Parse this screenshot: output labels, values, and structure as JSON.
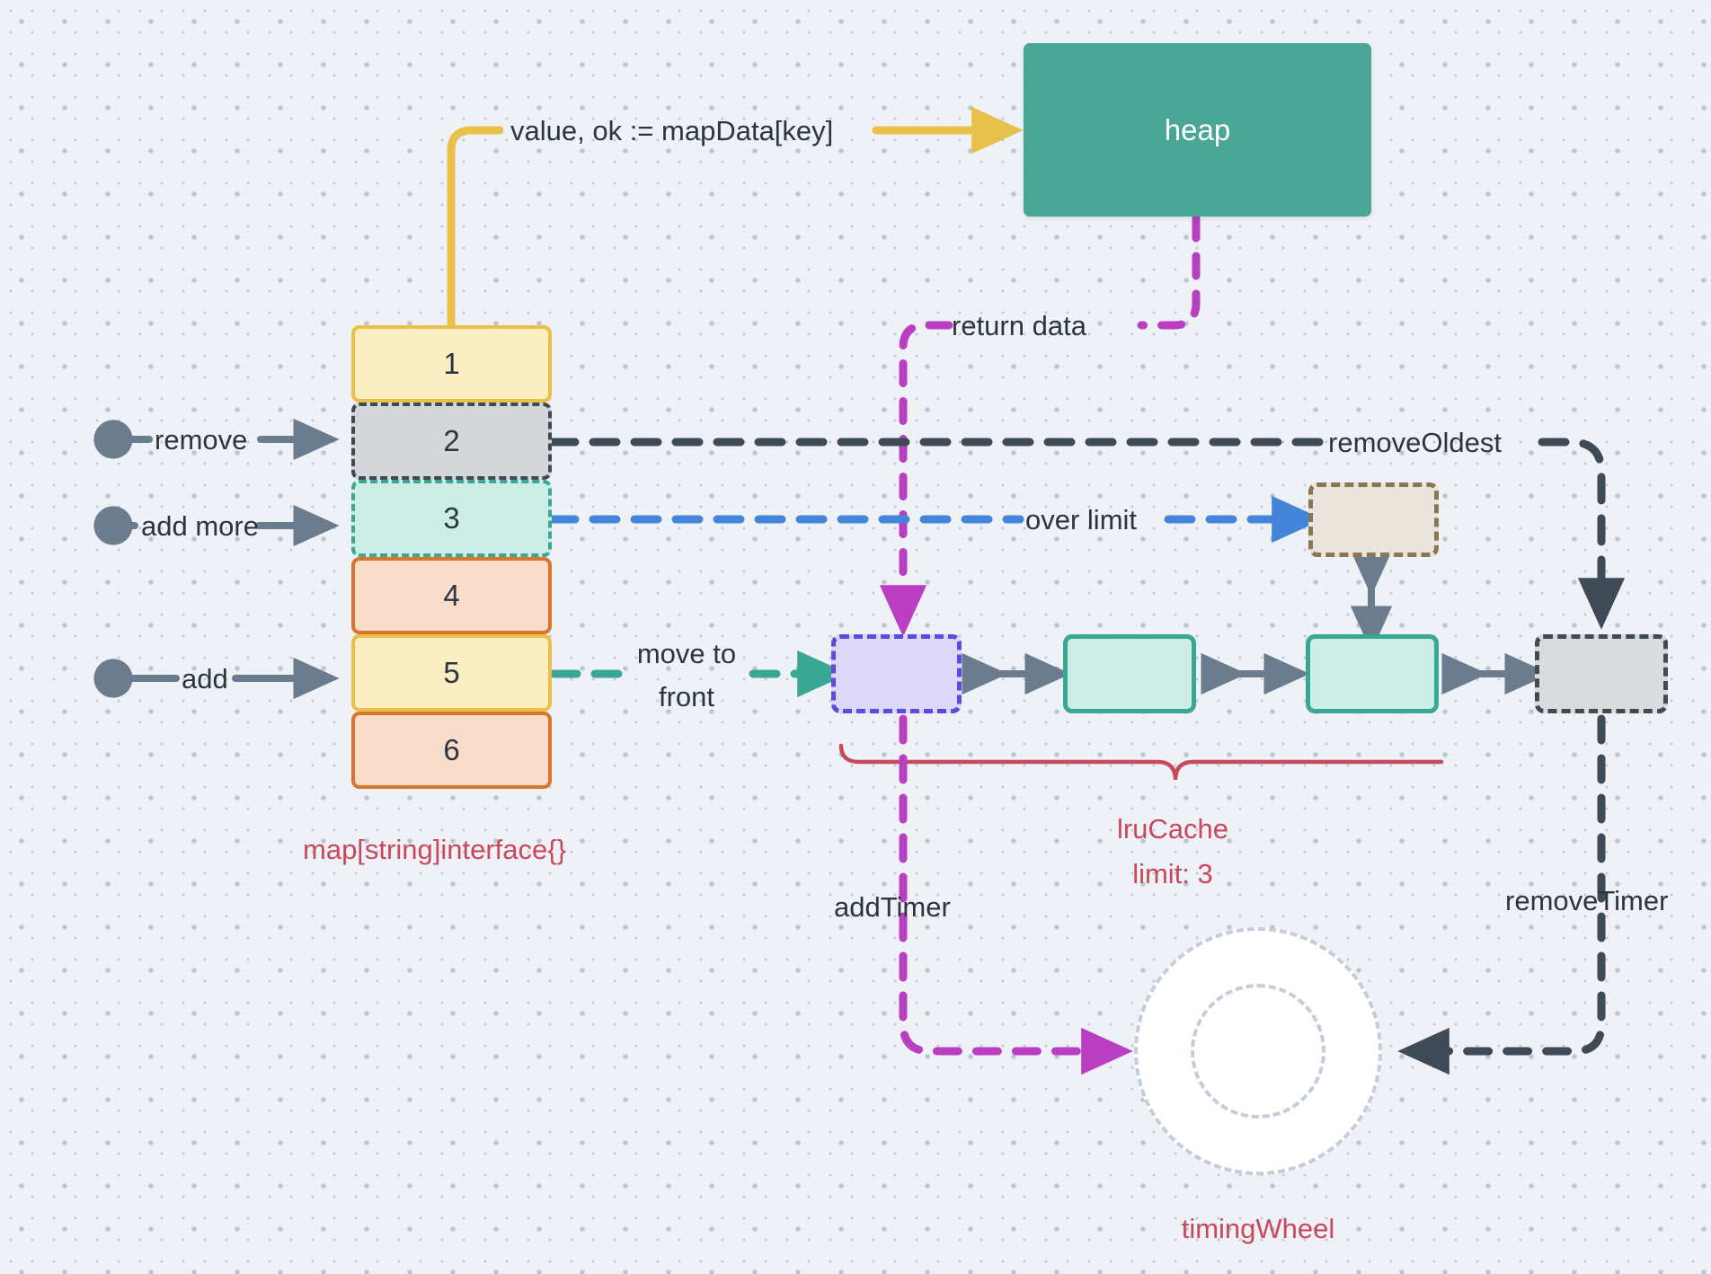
{
  "diagram": {
    "title": "Go cache architecture: map, lruCache, heap and timingWheel",
    "background_color": "#eef2f6"
  },
  "heap": {
    "label": "heap",
    "fill": "#4aa795",
    "text_color": "#ffffff"
  },
  "map_stack": {
    "caption": "map[string]interface{}",
    "caption_color": "#c8485c",
    "cells": [
      {
        "label": "1",
        "fill": "#fbeec2",
        "border": "#e8c04a",
        "border_style": "solid"
      },
      {
        "label": "2",
        "fill": "#d4d6d8",
        "border": "#3f4a57",
        "border_style": "dashed"
      },
      {
        "label": "3",
        "fill": "#cdeee5",
        "border": "#3aa795",
        "border_style": "dashed"
      },
      {
        "label": "4",
        "fill": "#f8ddcb",
        "border": "#d9762e",
        "border_style": "solid"
      },
      {
        "label": "5",
        "fill": "#fbeec2",
        "border": "#e8c04a",
        "border_style": "solid"
      },
      {
        "label": "6",
        "fill": "#f8ddcb",
        "border": "#d9762e",
        "border_style": "solid"
      }
    ]
  },
  "lru": {
    "caption_line1": "lruCache",
    "caption_line2": "limit: 3",
    "caption_color": "#c8485c",
    "brace_color": "#c8485c",
    "nodes": [
      {
        "name": "new-node",
        "fill": "#ddd8f8",
        "border": "#5b4be0",
        "border_style": "dashed"
      },
      {
        "name": "cache-node-1",
        "fill": "#cdeee5",
        "border": "#3aa795",
        "border_style": "solid"
      },
      {
        "name": "cache-node-2",
        "fill": "#cdeee5",
        "border": "#3aa795",
        "border_style": "solid"
      },
      {
        "name": "oldest-node",
        "fill": "#d9dbdd",
        "border": "#3f4a57",
        "border_style": "dashed"
      }
    ],
    "evicted_box": {
      "fill": "#e9e5dd",
      "border": "#8a7752",
      "border_style": "dashed"
    }
  },
  "timing_wheel": {
    "caption": "timingWheel",
    "caption_color": "#c8485c",
    "fill": "#ffffff",
    "border": "#c4cdd9"
  },
  "edges": {
    "map_lookup": {
      "label": "value, ok := mapData[key]",
      "color": "#e8c04a"
    },
    "return_data": {
      "label": "return data",
      "color": "#b93ec1"
    },
    "remove": {
      "label": "remove",
      "color": "#6b7c8f"
    },
    "add_more": {
      "label": "add more",
      "color": "#6b7c8f"
    },
    "add": {
      "label": "add",
      "color": "#6b7c8f"
    },
    "move_to_front_line1": {
      "label": "move to",
      "color": "#3aa795"
    },
    "move_to_front_line2": {
      "label": "front",
      "color": "#3aa795"
    },
    "over_limit": {
      "label": "over limit",
      "color": "#4285d9"
    },
    "remove_oldest": {
      "label": "removeOldest",
      "color": "#3f4a57"
    },
    "add_timer": {
      "label": "addTimer",
      "color": "#b93ec1"
    },
    "remove_timer": {
      "label": "removeTimer",
      "color": "#3f4a57"
    }
  }
}
